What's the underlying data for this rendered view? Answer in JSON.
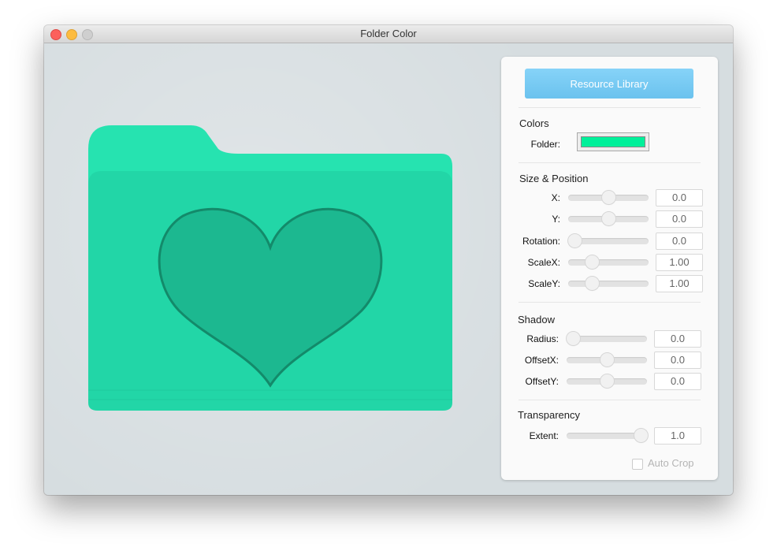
{
  "window": {
    "title": "Folder Color"
  },
  "colors": {
    "folder": "#00f09a",
    "folder_body": "#22d6a7",
    "folder_back": "#26e3b0",
    "heart": "#1cb890",
    "accent": "#6bc2ee"
  },
  "panel": {
    "resource_button": "Resource Library",
    "colors_section": {
      "title": "Colors",
      "folder_label": "Folder:"
    },
    "size_section": {
      "title": "Size & Position",
      "rows": [
        {
          "label": "X:",
          "value": "0.0",
          "fraction": 0.5
        },
        {
          "label": "Y:",
          "value": "0.0",
          "fraction": 0.5
        },
        {
          "label": "Rotation:",
          "value": "0.0",
          "fraction": 0.0
        },
        {
          "label": "ScaleX:",
          "value": "1.00",
          "fraction": 0.25
        },
        {
          "label": "ScaleY:",
          "value": "1.00",
          "fraction": 0.25
        }
      ]
    },
    "shadow_section": {
      "title": "Shadow",
      "rows": [
        {
          "label": "Radius:",
          "value": "0.0",
          "fraction": 0.0
        },
        {
          "label": "OffsetX:",
          "value": "0.0",
          "fraction": 0.5
        },
        {
          "label": "OffsetY:",
          "value": "0.0",
          "fraction": 0.5
        }
      ]
    },
    "transparency_section": {
      "title": "Transparency",
      "rows": [
        {
          "label": "Extent:",
          "value": "1.0",
          "fraction": 1.0
        }
      ]
    },
    "auto_crop": {
      "label": "Auto Crop",
      "checked": false
    }
  }
}
